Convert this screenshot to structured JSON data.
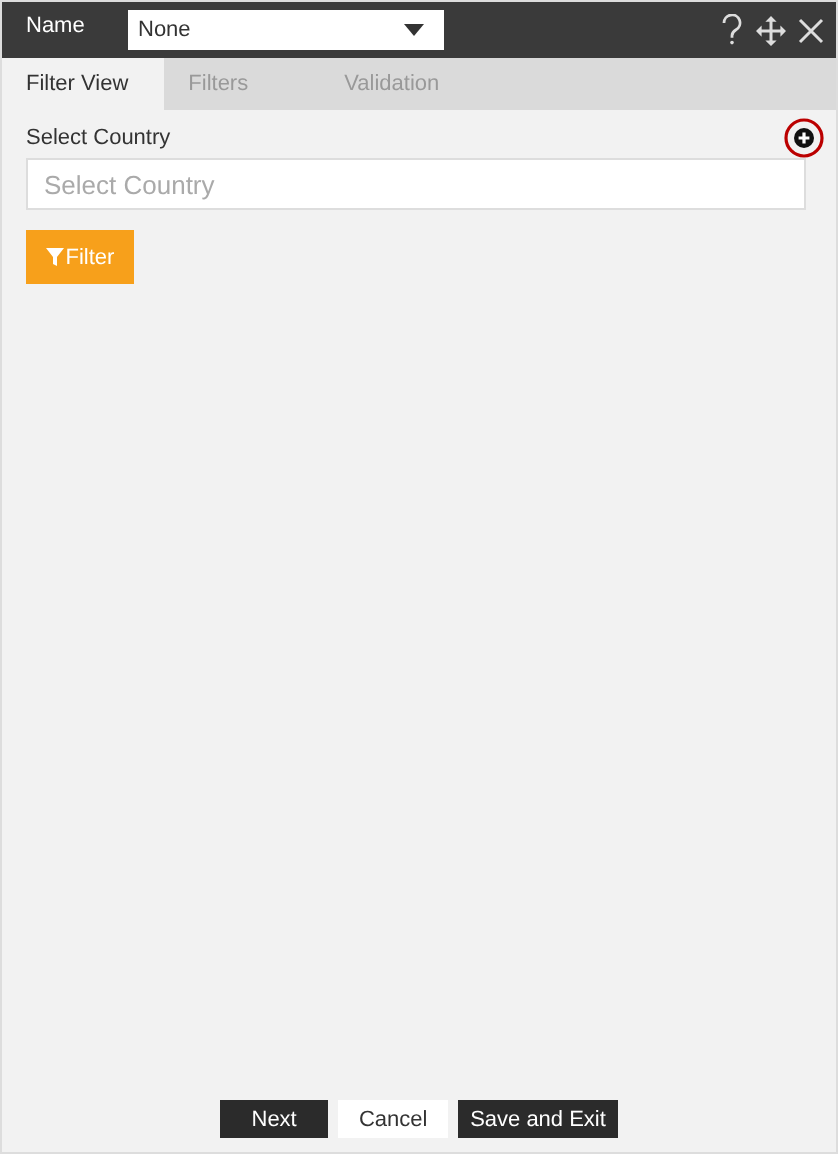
{
  "header": {
    "label": "Name",
    "dropdown": {
      "value": "None"
    }
  },
  "tabs": [
    {
      "label": "Filter View",
      "selected": true
    },
    {
      "label": "Filters",
      "selected": false
    },
    {
      "label": "Validation",
      "selected": false
    }
  ],
  "field": {
    "label": "Select Country",
    "placeholder": "Select Country"
  },
  "filter_button": "Filter",
  "footer_buttons": [
    {
      "label": "Next",
      "kind": "dark"
    },
    {
      "label": "Cancel",
      "kind": "light"
    },
    {
      "label": "Save and Exit",
      "kind": "dark"
    }
  ]
}
